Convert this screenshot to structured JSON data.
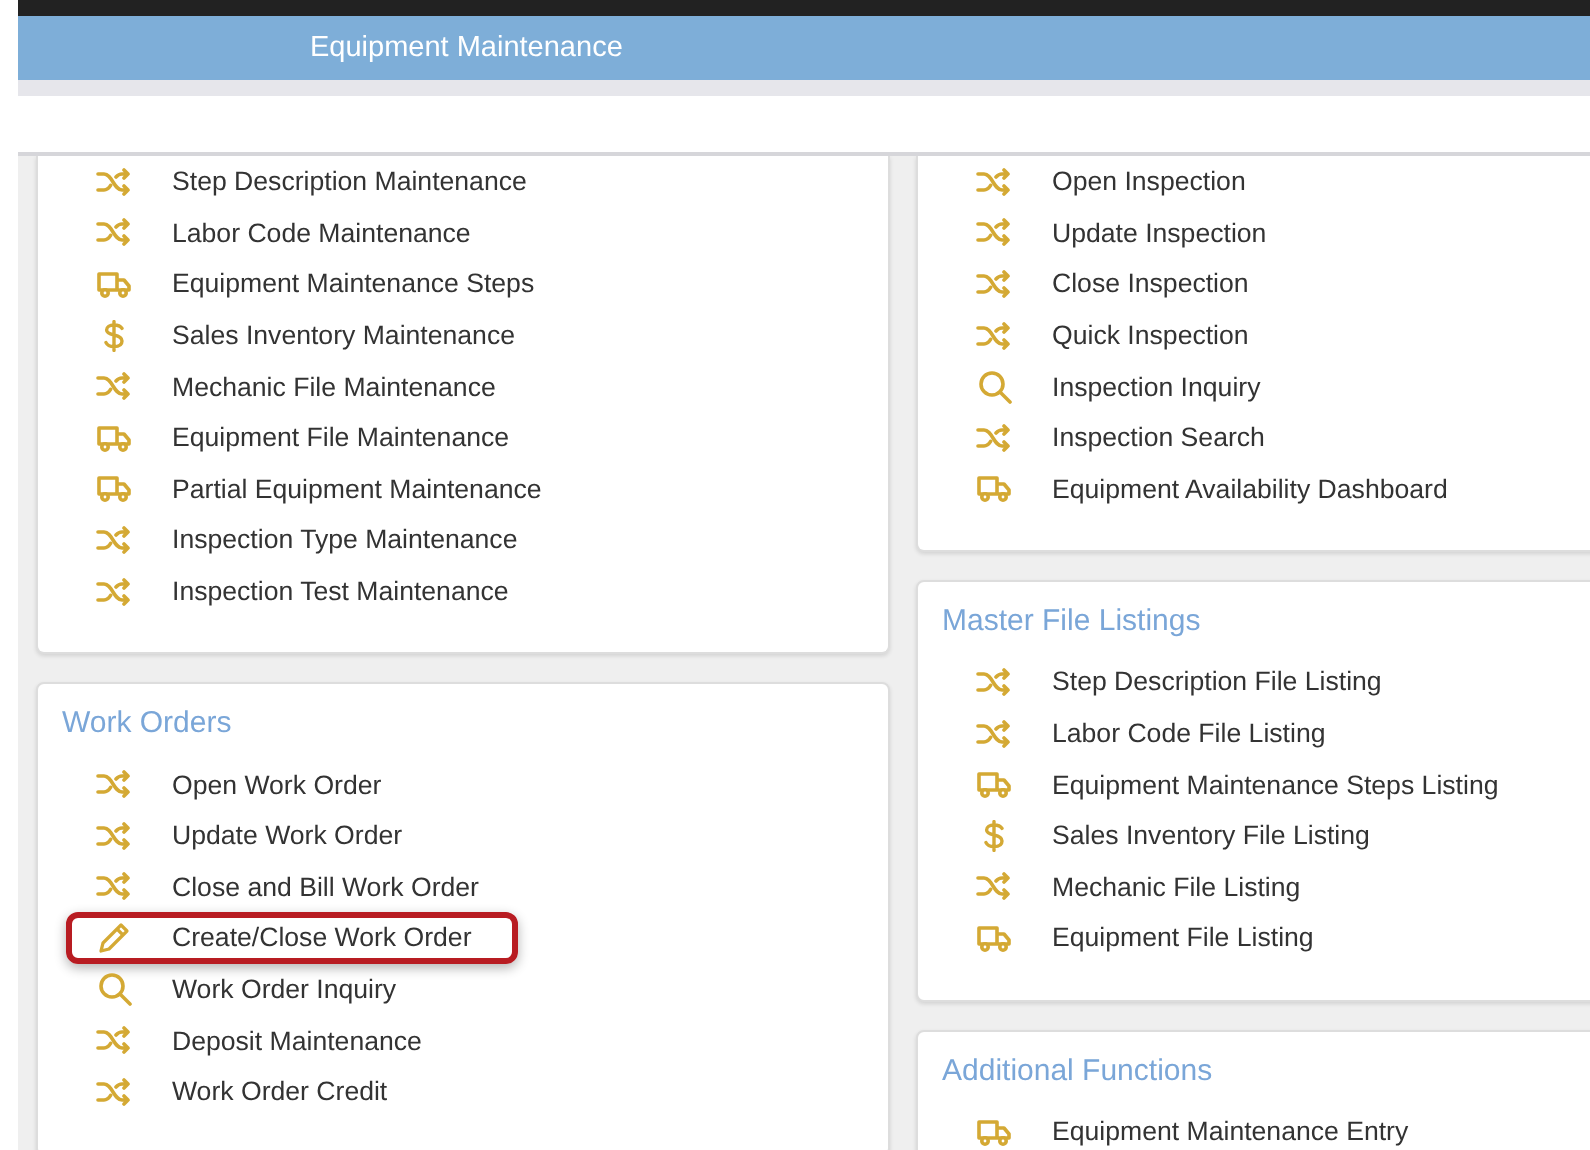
{
  "header": {
    "title": "Equipment Maintenance"
  },
  "columns": [
    {
      "cards": [
        {
          "items": [
            {
              "kind": "shuffle",
              "label": "Step Description Maintenance",
              "highlighted": false
            },
            {
              "kind": "shuffle",
              "label": "Labor Code Maintenance",
              "highlighted": false
            },
            {
              "kind": "truck",
              "label": "Equipment Maintenance Steps",
              "highlighted": false
            },
            {
              "kind": "dollar",
              "label": "Sales Inventory Maintenance",
              "highlighted": false
            },
            {
              "kind": "shuffle",
              "label": "Mechanic File Maintenance",
              "highlighted": false
            },
            {
              "kind": "truck",
              "label": "Equipment File Maintenance",
              "highlighted": false
            },
            {
              "kind": "truck",
              "label": "Partial Equipment Maintenance",
              "highlighted": false
            },
            {
              "kind": "shuffle",
              "label": "Inspection Type Maintenance",
              "highlighted": false
            },
            {
              "kind": "shuffle",
              "label": "Inspection Test Maintenance",
              "highlighted": false
            }
          ]
        },
        {
          "title": "Work Orders",
          "items": [
            {
              "kind": "shuffle",
              "label": "Open Work Order",
              "highlighted": false
            },
            {
              "kind": "shuffle",
              "label": "Update Work Order",
              "highlighted": false
            },
            {
              "kind": "shuffle",
              "label": "Close and Bill Work Order",
              "highlighted": false
            },
            {
              "kind": "pencil",
              "label": "Create/Close Work Order",
              "highlighted": true
            },
            {
              "kind": "search",
              "label": "Work Order Inquiry",
              "highlighted": false
            },
            {
              "kind": "shuffle",
              "label": "Deposit Maintenance",
              "highlighted": false
            },
            {
              "kind": "shuffle",
              "label": "Work Order Credit",
              "highlighted": false
            }
          ]
        }
      ]
    },
    {
      "cards": [
        {
          "items": [
            {
              "kind": "shuffle",
              "label": "Open Inspection",
              "highlighted": false
            },
            {
              "kind": "shuffle",
              "label": "Update Inspection",
              "highlighted": false
            },
            {
              "kind": "shuffle",
              "label": "Close Inspection",
              "highlighted": false
            },
            {
              "kind": "shuffle",
              "label": "Quick Inspection",
              "highlighted": false
            },
            {
              "kind": "search",
              "label": "Inspection Inquiry",
              "highlighted": false
            },
            {
              "kind": "shuffle",
              "label": "Inspection Search",
              "highlighted": false
            },
            {
              "kind": "truck",
              "label": "Equipment Availability Dashboard",
              "highlighted": false
            }
          ]
        },
        {
          "title": "Master File Listings",
          "items": [
            {
              "kind": "shuffle",
              "label": "Step Description File Listing",
              "highlighted": false
            },
            {
              "kind": "shuffle",
              "label": "Labor Code File Listing",
              "highlighted": false
            },
            {
              "kind": "truck",
              "label": "Equipment Maintenance Steps Listing",
              "highlighted": false
            },
            {
              "kind": "dollar",
              "label": "Sales Inventory File Listing",
              "highlighted": false
            },
            {
              "kind": "shuffle",
              "label": "Mechanic File Listing",
              "highlighted": false
            },
            {
              "kind": "truck",
              "label": "Equipment File Listing",
              "highlighted": false
            }
          ]
        },
        {
          "title": "Additional Functions",
          "items": [
            {
              "kind": "truck",
              "label": "Equipment Maintenance Entry",
              "highlighted": false
            }
          ]
        }
      ]
    }
  ]
}
